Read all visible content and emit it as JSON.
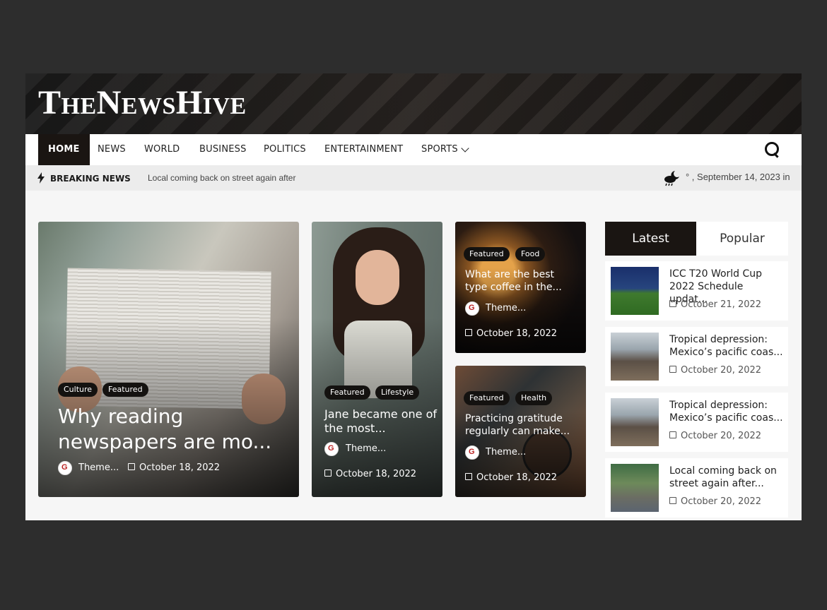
{
  "site": {
    "logo": "TheNewsHive"
  },
  "nav": {
    "items": [
      "HOME",
      "NEWS",
      "WORLD",
      "BUSINESS",
      "POLITICS",
      "ENTERTAINMENT",
      "SPORTS"
    ],
    "active": "HOME"
  },
  "breaking": {
    "label": "BREAKING NEWS",
    "ticker": "Local coming back on street again after",
    "date_text": "° , September 14, 2023 in"
  },
  "cards": [
    {
      "tags": [
        "Culture",
        "Featured"
      ],
      "title": "Why reading newspapers are mo...",
      "author": "Theme...",
      "date": "October 18, 2022"
    },
    {
      "tags": [
        "Featured",
        "Lifestyle"
      ],
      "title": "Jane became one of the most...",
      "author": "Theme...",
      "date": "October 18, 2022"
    },
    {
      "tags": [
        "Featured",
        "Food"
      ],
      "title": "What are the best type coffee in the...",
      "author": "Theme...",
      "date": "October 18, 2022"
    },
    {
      "tags": [
        "Featured",
        "Health"
      ],
      "title": "Practicing gratitude regularly can make...",
      "author": "Theme...",
      "date": "October 18, 2022"
    }
  ],
  "sidebar": {
    "tabs": [
      "Latest",
      "Popular"
    ],
    "active_tab": "Latest",
    "items": [
      {
        "title": "ICC T20 World Cup 2022 Schedule updat...",
        "date": "October 21, 2022",
        "thumb": "stadium"
      },
      {
        "title": "Tropical depression: Mexico’s pacific coas...",
        "date": "October 20, 2022",
        "thumb": "storm"
      },
      {
        "title": "Tropical depression: Mexico’s pacific coas...",
        "date": "October 20, 2022",
        "thumb": "storm"
      },
      {
        "title": "Local coming back on street again after...",
        "date": "October 20, 2022",
        "thumb": "street"
      }
    ]
  },
  "colors": {
    "accent": "#1a1512",
    "frame": "#2d2d2d",
    "page": "#f6f6f6"
  }
}
